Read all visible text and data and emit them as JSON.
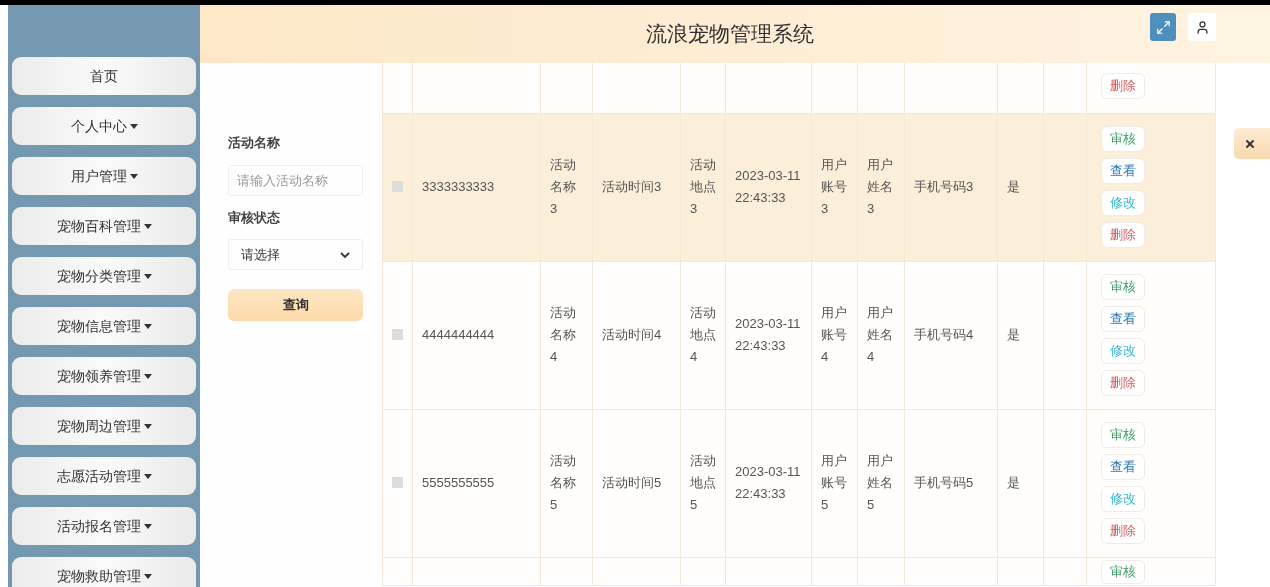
{
  "header": {
    "title": "流浪宠物管理系统"
  },
  "sidebar": {
    "items": [
      {
        "label": "首页",
        "has_menu": false
      },
      {
        "label": "个人中心",
        "has_menu": true
      },
      {
        "label": "用户管理",
        "has_menu": true
      },
      {
        "label": "宠物百科管理",
        "has_menu": true
      },
      {
        "label": "宠物分类管理",
        "has_menu": true
      },
      {
        "label": "宠物信息管理",
        "has_menu": true
      },
      {
        "label": "宠物领养管理",
        "has_menu": true
      },
      {
        "label": "宠物周边管理",
        "has_menu": true
      },
      {
        "label": "志愿活动管理",
        "has_menu": true
      },
      {
        "label": "活动报名管理",
        "has_menu": true
      },
      {
        "label": "宠物救助管理",
        "has_menu": true
      }
    ]
  },
  "search": {
    "name_label": "活动名称",
    "name_placeholder": "请输入活动名称",
    "status_label": "审核状态",
    "status_value": "请选择",
    "button": "查询"
  },
  "table": {
    "rows": [
      {
        "kind": "partial_top",
        "actions": [
          {
            "kind": "delete",
            "label": "删除"
          }
        ]
      },
      {
        "kind": "full",
        "checked": false,
        "highlighted": true,
        "cells": [
          "3333333333",
          "活动名称3",
          "活动时间3",
          "活动地点3",
          "2023-03-11 22:43:33",
          "用户账号3",
          "用户姓名3",
          "手机号码3",
          "是"
        ],
        "actions": [
          {
            "kind": "review",
            "label": "审核"
          },
          {
            "kind": "view",
            "label": "查看"
          },
          {
            "kind": "edit",
            "label": "修改"
          },
          {
            "kind": "delete",
            "label": "删除"
          }
        ]
      },
      {
        "kind": "full",
        "checked": false,
        "highlighted": false,
        "cells": [
          "4444444444",
          "活动名称4",
          "活动时间4",
          "活动地点4",
          "2023-03-11 22:43:33",
          "用户账号4",
          "用户姓名4",
          "手机号码4",
          "是"
        ],
        "actions": [
          {
            "kind": "review",
            "label": "审核"
          },
          {
            "kind": "view",
            "label": "查看"
          },
          {
            "kind": "edit",
            "label": "修改"
          },
          {
            "kind": "delete",
            "label": "删除"
          }
        ]
      },
      {
        "kind": "full",
        "checked": false,
        "highlighted": false,
        "cells": [
          "5555555555",
          "活动名称5",
          "活动时间5",
          "活动地点5",
          "2023-03-11 22:43:33",
          "用户账号5",
          "用户姓名5",
          "手机号码5",
          "是"
        ],
        "actions": [
          {
            "kind": "review",
            "label": "审核"
          },
          {
            "kind": "view",
            "label": "查看"
          },
          {
            "kind": "edit",
            "label": "修改"
          },
          {
            "kind": "delete",
            "label": "删除"
          }
        ]
      },
      {
        "kind": "partial_bottom",
        "actions": [
          {
            "kind": "review",
            "label": "审核"
          }
        ]
      }
    ]
  }
}
